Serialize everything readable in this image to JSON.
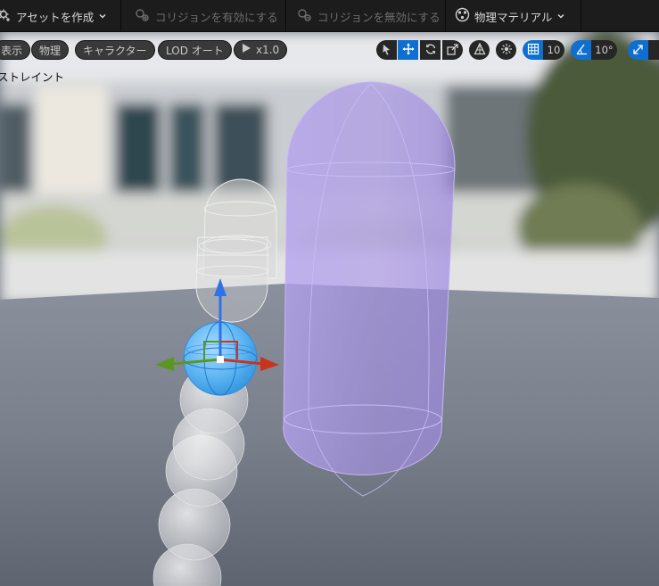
{
  "toolbar": {
    "create_asset": "アセットを作成",
    "enable_collision": "コリジョンを有効にする",
    "disable_collision": "コリジョンを無効にする",
    "physics_material": "物理マテリアル"
  },
  "viewport": {
    "pills": {
      "show": "表示",
      "physics": "物理",
      "character": "キャラクター",
      "lod": "LOD オート",
      "speed": "x1.0"
    },
    "grid_snap_value": "10",
    "rotation_snap_value": "10°",
    "constraint_label": "ストレイント"
  },
  "colors": {
    "toolbar_bg": "#1c1c1c",
    "accent_blue": "#0e6fd1",
    "capsule_purple": "#a58cf0",
    "selected_sphere": "#52aef0"
  }
}
